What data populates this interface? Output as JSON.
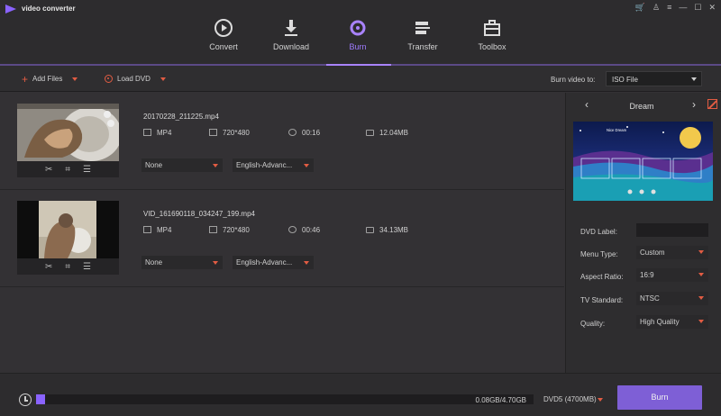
{
  "app": {
    "title": "video converter",
    "brand_color": "#8a63ff",
    "accent_color": "#e25c43"
  },
  "window_controls": [
    "cart-icon",
    "user-icon",
    "menu-icon",
    "minimize-icon",
    "maximize-icon",
    "close-icon"
  ],
  "nav": {
    "active": "Burn",
    "tabs": [
      {
        "label": "Convert",
        "icon": "convert-icon"
      },
      {
        "label": "Download",
        "icon": "download-icon"
      },
      {
        "label": "Burn",
        "icon": "burn-disc-icon"
      },
      {
        "label": "Transfer",
        "icon": "transfer-icon"
      },
      {
        "label": "Toolbox",
        "icon": "toolbox-icon"
      }
    ]
  },
  "toolbar": {
    "add_files": "Add Files",
    "load_dvd": "Load DVD",
    "burn_to_label": "Burn video to:",
    "burn_to_value": "ISO File"
  },
  "files": [
    {
      "name": "20170228_211225.mp4",
      "format": "MP4",
      "resolution": "720*480",
      "duration": "00:16",
      "size": "12.04MB",
      "subtitle": "None",
      "audio": "English-Advanc..."
    },
    {
      "name": "VID_161690118_034247_199.mp4",
      "format": "MP4",
      "resolution": "720*480",
      "duration": "00:46",
      "size": "34.13MB",
      "subtitle": "None",
      "audio": "English-Advanc..."
    }
  ],
  "panel": {
    "theme_name": "Dream",
    "preview_title": "Nice Dream",
    "dvd_label_label": "DVD Label:",
    "dvd_label_value": "",
    "menu_type_label": "Menu Type:",
    "menu_type_value": "Custom",
    "aspect_label": "Aspect Ratio:",
    "aspect_value": "16:9",
    "tv_label": "TV Standard:",
    "tv_value": "NTSC",
    "quality_label": "Quality:",
    "quality_value": "High Quality"
  },
  "bottom": {
    "storage_text": "0.08GB/4.70GB",
    "progress_fraction": 0.016,
    "disc_type": "DVD5 (4700MB)",
    "burn_label": "Burn"
  }
}
